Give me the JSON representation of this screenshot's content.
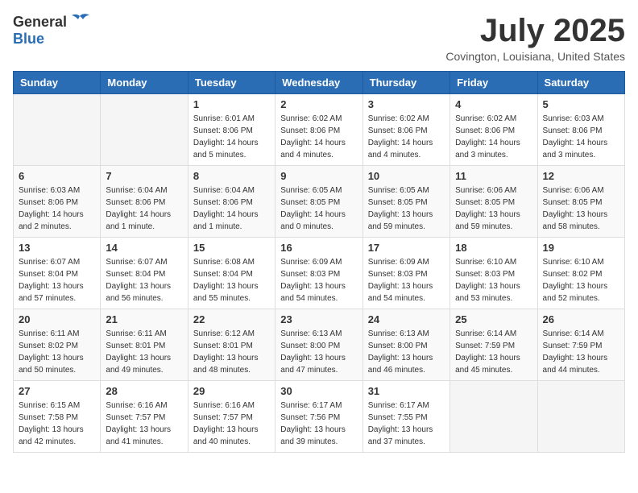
{
  "header": {
    "logo_general": "General",
    "logo_blue": "Blue",
    "title": "July 2025",
    "subtitle": "Covington, Louisiana, United States"
  },
  "weekdays": [
    "Sunday",
    "Monday",
    "Tuesday",
    "Wednesday",
    "Thursday",
    "Friday",
    "Saturday"
  ],
  "weeks": [
    [
      {
        "day": "",
        "info": ""
      },
      {
        "day": "",
        "info": ""
      },
      {
        "day": "1",
        "info": "Sunrise: 6:01 AM\nSunset: 8:06 PM\nDaylight: 14 hours\nand 5 minutes."
      },
      {
        "day": "2",
        "info": "Sunrise: 6:02 AM\nSunset: 8:06 PM\nDaylight: 14 hours\nand 4 minutes."
      },
      {
        "day": "3",
        "info": "Sunrise: 6:02 AM\nSunset: 8:06 PM\nDaylight: 14 hours\nand 4 minutes."
      },
      {
        "day": "4",
        "info": "Sunrise: 6:02 AM\nSunset: 8:06 PM\nDaylight: 14 hours\nand 3 minutes."
      },
      {
        "day": "5",
        "info": "Sunrise: 6:03 AM\nSunset: 8:06 PM\nDaylight: 14 hours\nand 3 minutes."
      }
    ],
    [
      {
        "day": "6",
        "info": "Sunrise: 6:03 AM\nSunset: 8:06 PM\nDaylight: 14 hours\nand 2 minutes."
      },
      {
        "day": "7",
        "info": "Sunrise: 6:04 AM\nSunset: 8:06 PM\nDaylight: 14 hours\nand 1 minute."
      },
      {
        "day": "8",
        "info": "Sunrise: 6:04 AM\nSunset: 8:06 PM\nDaylight: 14 hours\nand 1 minute."
      },
      {
        "day": "9",
        "info": "Sunrise: 6:05 AM\nSunset: 8:05 PM\nDaylight: 14 hours\nand 0 minutes."
      },
      {
        "day": "10",
        "info": "Sunrise: 6:05 AM\nSunset: 8:05 PM\nDaylight: 13 hours\nand 59 minutes."
      },
      {
        "day": "11",
        "info": "Sunrise: 6:06 AM\nSunset: 8:05 PM\nDaylight: 13 hours\nand 59 minutes."
      },
      {
        "day": "12",
        "info": "Sunrise: 6:06 AM\nSunset: 8:05 PM\nDaylight: 13 hours\nand 58 minutes."
      }
    ],
    [
      {
        "day": "13",
        "info": "Sunrise: 6:07 AM\nSunset: 8:04 PM\nDaylight: 13 hours\nand 57 minutes."
      },
      {
        "day": "14",
        "info": "Sunrise: 6:07 AM\nSunset: 8:04 PM\nDaylight: 13 hours\nand 56 minutes."
      },
      {
        "day": "15",
        "info": "Sunrise: 6:08 AM\nSunset: 8:04 PM\nDaylight: 13 hours\nand 55 minutes."
      },
      {
        "day": "16",
        "info": "Sunrise: 6:09 AM\nSunset: 8:03 PM\nDaylight: 13 hours\nand 54 minutes."
      },
      {
        "day": "17",
        "info": "Sunrise: 6:09 AM\nSunset: 8:03 PM\nDaylight: 13 hours\nand 54 minutes."
      },
      {
        "day": "18",
        "info": "Sunrise: 6:10 AM\nSunset: 8:03 PM\nDaylight: 13 hours\nand 53 minutes."
      },
      {
        "day": "19",
        "info": "Sunrise: 6:10 AM\nSunset: 8:02 PM\nDaylight: 13 hours\nand 52 minutes."
      }
    ],
    [
      {
        "day": "20",
        "info": "Sunrise: 6:11 AM\nSunset: 8:02 PM\nDaylight: 13 hours\nand 50 minutes."
      },
      {
        "day": "21",
        "info": "Sunrise: 6:11 AM\nSunset: 8:01 PM\nDaylight: 13 hours\nand 49 minutes."
      },
      {
        "day": "22",
        "info": "Sunrise: 6:12 AM\nSunset: 8:01 PM\nDaylight: 13 hours\nand 48 minutes."
      },
      {
        "day": "23",
        "info": "Sunrise: 6:13 AM\nSunset: 8:00 PM\nDaylight: 13 hours\nand 47 minutes."
      },
      {
        "day": "24",
        "info": "Sunrise: 6:13 AM\nSunset: 8:00 PM\nDaylight: 13 hours\nand 46 minutes."
      },
      {
        "day": "25",
        "info": "Sunrise: 6:14 AM\nSunset: 7:59 PM\nDaylight: 13 hours\nand 45 minutes."
      },
      {
        "day": "26",
        "info": "Sunrise: 6:14 AM\nSunset: 7:59 PM\nDaylight: 13 hours\nand 44 minutes."
      }
    ],
    [
      {
        "day": "27",
        "info": "Sunrise: 6:15 AM\nSunset: 7:58 PM\nDaylight: 13 hours\nand 42 minutes."
      },
      {
        "day": "28",
        "info": "Sunrise: 6:16 AM\nSunset: 7:57 PM\nDaylight: 13 hours\nand 41 minutes."
      },
      {
        "day": "29",
        "info": "Sunrise: 6:16 AM\nSunset: 7:57 PM\nDaylight: 13 hours\nand 40 minutes."
      },
      {
        "day": "30",
        "info": "Sunrise: 6:17 AM\nSunset: 7:56 PM\nDaylight: 13 hours\nand 39 minutes."
      },
      {
        "day": "31",
        "info": "Sunrise: 6:17 AM\nSunset: 7:55 PM\nDaylight: 13 hours\nand 37 minutes."
      },
      {
        "day": "",
        "info": ""
      },
      {
        "day": "",
        "info": ""
      }
    ]
  ]
}
